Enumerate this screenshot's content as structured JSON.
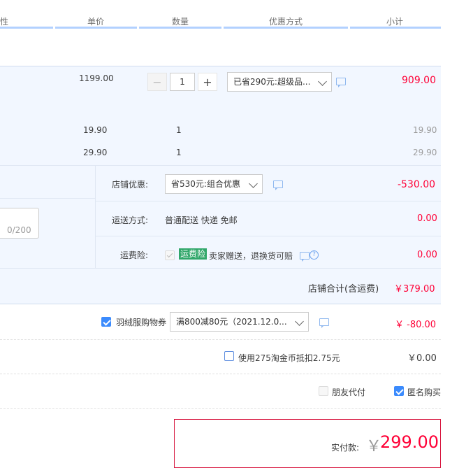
{
  "header": {
    "col_attr": "性",
    "col_price": "单价",
    "col_qty": "数量",
    "col_discount": "优惠方式",
    "col_subtotal": "小计"
  },
  "items": [
    {
      "price": "1199.00",
      "qty": "1",
      "discount": "已省290元:超级品...",
      "subtotal": "909.00"
    },
    {
      "price": "19.90",
      "qty": "1",
      "subtotal": "19.90"
    },
    {
      "price": "29.90",
      "qty": "1",
      "subtotal": "29.90"
    }
  ],
  "shop": {
    "promo_label": "店铺优惠:",
    "promo_value": "省530元:组合优惠",
    "promo_amount": "-530.00",
    "ship_label": "运送方式:",
    "ship_value": "普通配送 快递 免邮",
    "ship_amount": "0.00",
    "insurance_label": "运费险:",
    "insurance_badge": "运费险",
    "insurance_desc": "卖家赠送，退换货可赔",
    "insurance_amount": "0.00",
    "memo_counter": "0/200",
    "total_label": "店铺合计(含运费)",
    "total_amount": "￥379.00"
  },
  "coupon": {
    "label": "羽绒服购物券",
    "value": "满800减80元（2021.12.0...",
    "amount": "￥ -80.00"
  },
  "taojinbi": {
    "label": "使用275淘金币抵扣2.75元",
    "amount": "￥0.00"
  },
  "options": {
    "friend_pay": "朋友代付",
    "anonymous": "匿名购买"
  },
  "pay": {
    "label": "实付款:",
    "currency": "￥",
    "amount": "299.00"
  },
  "colors": {
    "accent_red": "#ff0036",
    "band_blue": "#f2f7ff",
    "checkbox_blue": "#3b8bfd",
    "insurance_green": "#31a76a"
  }
}
